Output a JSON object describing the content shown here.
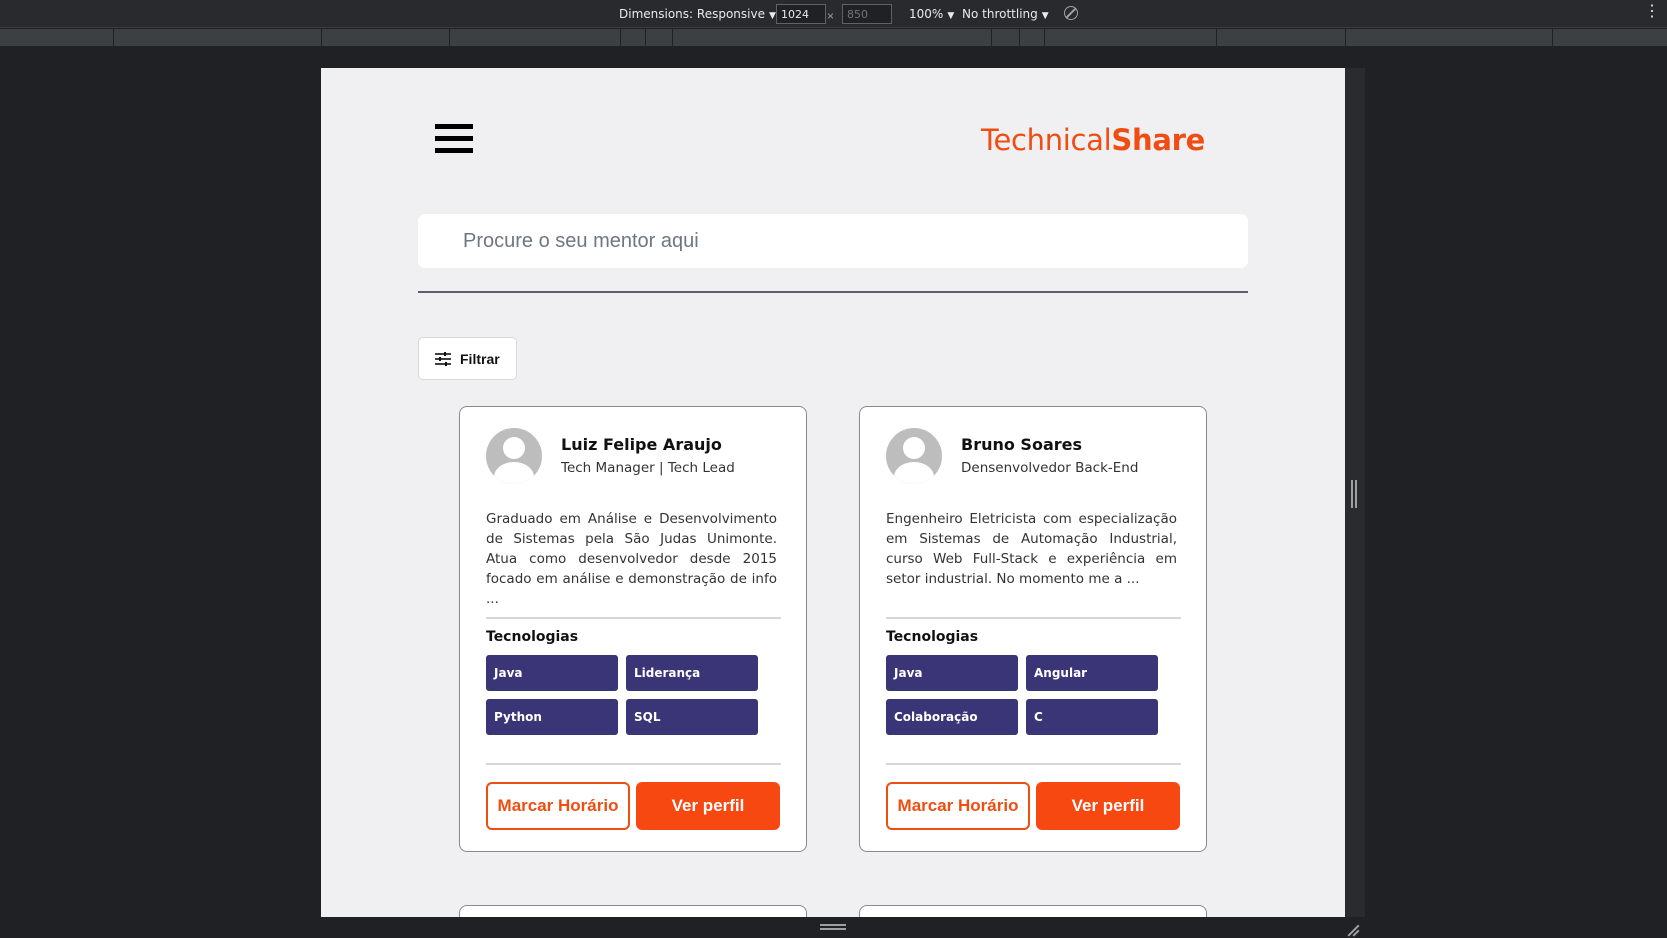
{
  "devtools": {
    "dimensions_label": "Dimensions: Responsive",
    "width_value": "1024",
    "height_value": "850",
    "times_sign": "×",
    "zoom_label": "100%",
    "throttling_label": "No throttling",
    "caret": "▼",
    "more_glyph": "⋮"
  },
  "header": {
    "logo_regular": "Technical",
    "logo_bold": "Share",
    "brand_color": "#f04d12"
  },
  "search": {
    "placeholder": "Procure o seu mentor aqui",
    "value": ""
  },
  "filter": {
    "label": "Filtrar",
    "icon": "sliders-icon"
  },
  "mentors": [
    {
      "name": "Luiz Felipe Araujo",
      "role": "Tech Manager | Tech Lead",
      "bio": "Graduado em Análise e Desenvolvimento de Sistemas pela São Judas Unimonte. Atua como desenvolvedor desde 2015 focado em análise e demonstração de info ...",
      "tech_title": "Tecnologias",
      "tags": [
        "Java",
        "Liderança",
        "Python",
        "SQL"
      ],
      "schedule_label": "Marcar Horário",
      "profile_label": "Ver perfil"
    },
    {
      "name": "Bruno Soares",
      "role": "Densenvolvedor Back-End",
      "bio": "Engenheiro Eletricista com especialização em Sistemas de Automação Industrial, curso Web Full-Stack e experiência em setor industrial. No momento me a ...",
      "tech_title": "Tecnologias",
      "tags": [
        "Java",
        "Angular",
        "Colaboração",
        "C"
      ],
      "schedule_label": "Marcar Horário",
      "profile_label": "Ver perfil"
    }
  ],
  "colors": {
    "tag_bg": "#3a3577",
    "accent": "#f84812",
    "page_bg": "#f0f0f2"
  }
}
